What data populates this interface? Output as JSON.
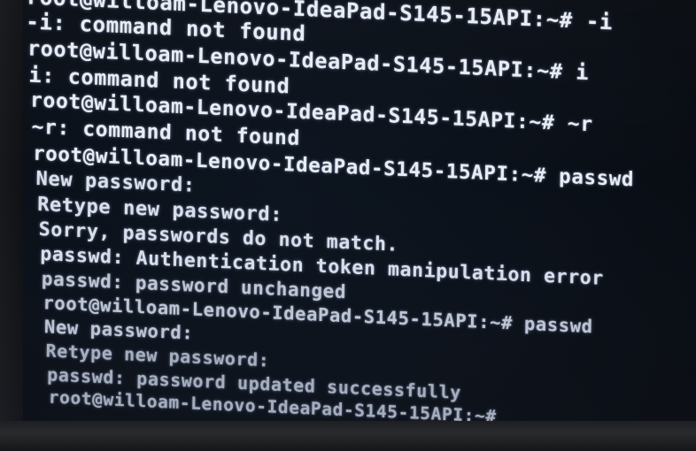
{
  "terminal": {
    "lines": [
      "root@willoam-Lenovo-IdeaPad-S145-15API:~# -i",
      "-i: command not found",
      "root@willoam-Lenovo-IdeaPad-S145-15API:~# i",
      "i: command not found",
      "root@willoam-Lenovo-IdeaPad-S145-15API:~# ~r",
      "~r: command not found",
      "root@willoam-Lenovo-IdeaPad-S145-15API:~# passwd",
      "New password:",
      "Retype new password:",
      "Sorry, passwords do not match.",
      "passwd: Authentication token manipulation error",
      "passwd: password unchanged",
      "root@willoam-Lenovo-IdeaPad-S145-15API:~# passwd",
      "New password:",
      "Retype new password:",
      "passwd: password updated successfully",
      "root@willoam-Lenovo-IdeaPad-S145-15API:~#"
    ],
    "cursor": "_"
  },
  "colors": {
    "text": "#e8edf5",
    "background": "#0a0f17",
    "bezel": "#1e1f22"
  }
}
